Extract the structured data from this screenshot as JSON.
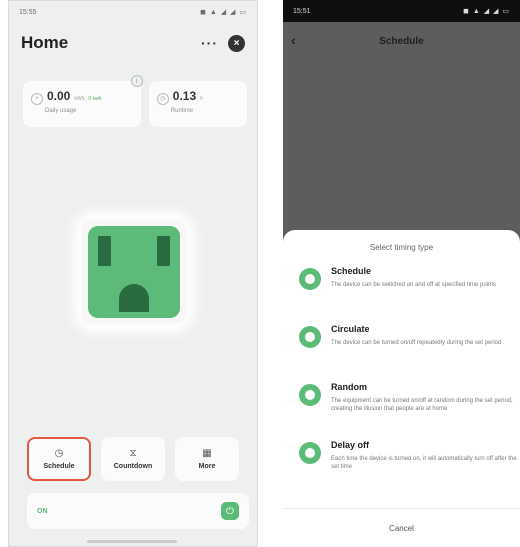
{
  "left": {
    "status": {
      "time": "15:55",
      "icons": "◼ ▲ ◢ ◢ ▭"
    },
    "header": {
      "title": "Home",
      "more": "···",
      "close": "×"
    },
    "stats": [
      {
        "value": "0.00",
        "unit": "kWh",
        "delta": "0 kwh",
        "label": "Daily usage"
      },
      {
        "value": "0.13",
        "unit": "h",
        "label": "Runtime"
      }
    ],
    "controls": [
      {
        "label": "Schedule",
        "icon": "clock-icon",
        "glyph": "◷"
      },
      {
        "label": "Countdown",
        "icon": "hourglass-icon",
        "glyph": "⧖"
      },
      {
        "label": "More",
        "icon": "grid-icon",
        "glyph": "▦"
      }
    ],
    "power": {
      "state": "ON",
      "glyph": "⏻"
    },
    "colors": {
      "accent": "#5dbb7a",
      "highlight": "#e4563f"
    }
  },
  "right": {
    "status": {
      "time": "15:51",
      "icons": "◼ ▲ ◢ ◢ ▭"
    },
    "header": {
      "title": "Schedule",
      "back": "‹"
    },
    "sheet": {
      "title": "Select timing type",
      "options": [
        {
          "title": "Schedule",
          "desc": "The device can be switched on and off at specified time points"
        },
        {
          "title": "Circulate",
          "desc": "The device can be turned on/off repeatedly during the set period"
        },
        {
          "title": "Random",
          "desc": "The equipment can be turned on/off at random during the set period, creating the illusion that people are at home"
        },
        {
          "title": "Delay off",
          "desc": "Each time the device is turned on, it will automatically turn off after the set time"
        }
      ],
      "cancel": "Cancel"
    }
  }
}
